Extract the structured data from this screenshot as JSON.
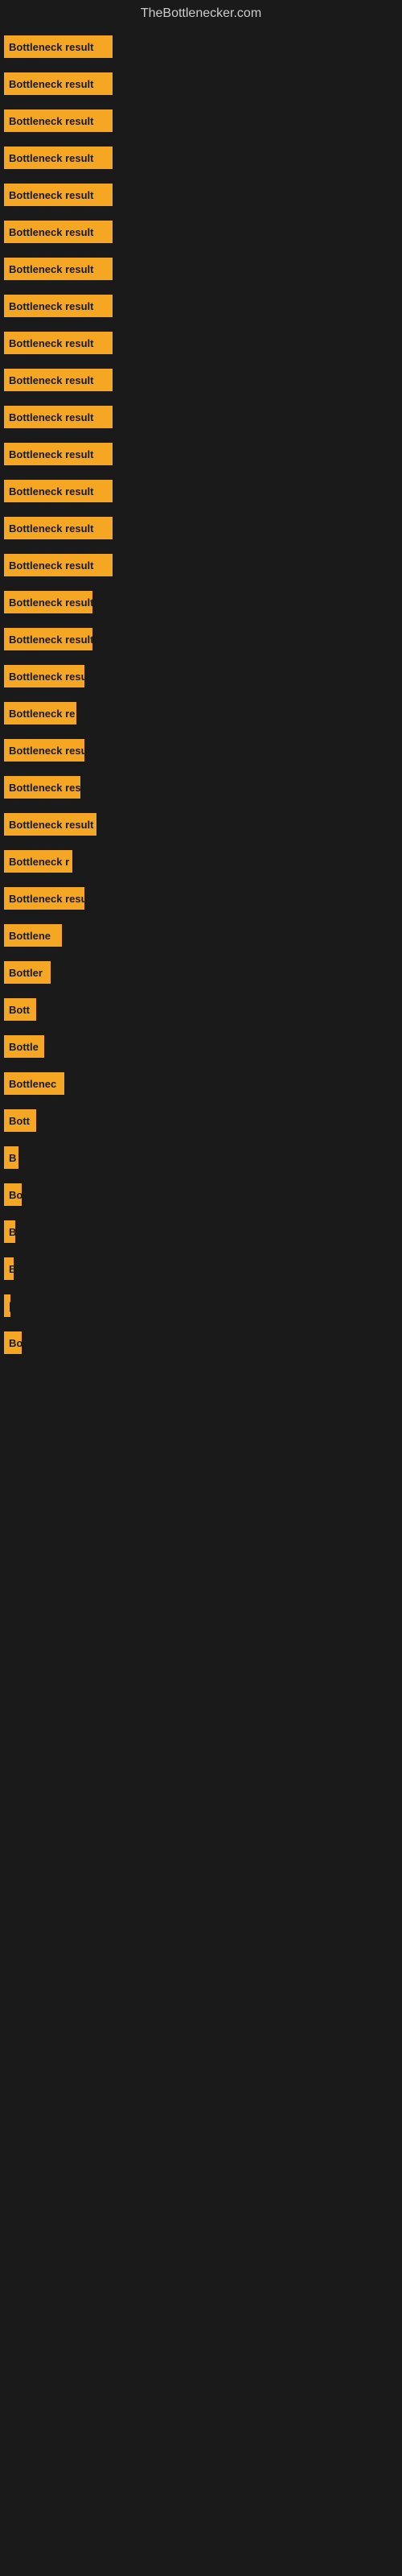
{
  "site": {
    "title": "TheBottlenecker.com"
  },
  "bars": [
    {
      "id": 1,
      "label": "Bottleneck result",
      "width": 135
    },
    {
      "id": 2,
      "label": "Bottleneck result",
      "width": 135
    },
    {
      "id": 3,
      "label": "Bottleneck result",
      "width": 135
    },
    {
      "id": 4,
      "label": "Bottleneck result",
      "width": 135
    },
    {
      "id": 5,
      "label": "Bottleneck result",
      "width": 135
    },
    {
      "id": 6,
      "label": "Bottleneck result",
      "width": 135
    },
    {
      "id": 7,
      "label": "Bottleneck result",
      "width": 135
    },
    {
      "id": 8,
      "label": "Bottleneck result",
      "width": 135
    },
    {
      "id": 9,
      "label": "Bottleneck result",
      "width": 135
    },
    {
      "id": 10,
      "label": "Bottleneck result",
      "width": 135
    },
    {
      "id": 11,
      "label": "Bottleneck result",
      "width": 135
    },
    {
      "id": 12,
      "label": "Bottleneck result",
      "width": 135
    },
    {
      "id": 13,
      "label": "Bottleneck result",
      "width": 135
    },
    {
      "id": 14,
      "label": "Bottleneck result",
      "width": 135
    },
    {
      "id": 15,
      "label": "Bottleneck result",
      "width": 135
    },
    {
      "id": 16,
      "label": "Bottleneck result",
      "width": 110
    },
    {
      "id": 17,
      "label": "Bottleneck result",
      "width": 110
    },
    {
      "id": 18,
      "label": "Bottleneck resu",
      "width": 100
    },
    {
      "id": 19,
      "label": "Bottleneck re",
      "width": 90
    },
    {
      "id": 20,
      "label": "Bottleneck resu",
      "width": 100
    },
    {
      "id": 21,
      "label": "Bottleneck res",
      "width": 95
    },
    {
      "id": 22,
      "label": "Bottleneck result",
      "width": 115
    },
    {
      "id": 23,
      "label": "Bottleneck r",
      "width": 85
    },
    {
      "id": 24,
      "label": "Bottleneck resu",
      "width": 100
    },
    {
      "id": 25,
      "label": "Bottlene",
      "width": 72
    },
    {
      "id": 26,
      "label": "Bottler",
      "width": 58
    },
    {
      "id": 27,
      "label": "Bott",
      "width": 40
    },
    {
      "id": 28,
      "label": "Bottle",
      "width": 50
    },
    {
      "id": 29,
      "label": "Bottlenec",
      "width": 75
    },
    {
      "id": 30,
      "label": "Bott",
      "width": 40
    },
    {
      "id": 31,
      "label": "B",
      "width": 18
    },
    {
      "id": 32,
      "label": "Bo",
      "width": 22
    },
    {
      "id": 33,
      "label": "B",
      "width": 14
    },
    {
      "id": 34,
      "label": "B",
      "width": 12
    },
    {
      "id": 35,
      "label": "|",
      "width": 8
    },
    {
      "id": 36,
      "label": "Bo",
      "width": 22
    }
  ]
}
